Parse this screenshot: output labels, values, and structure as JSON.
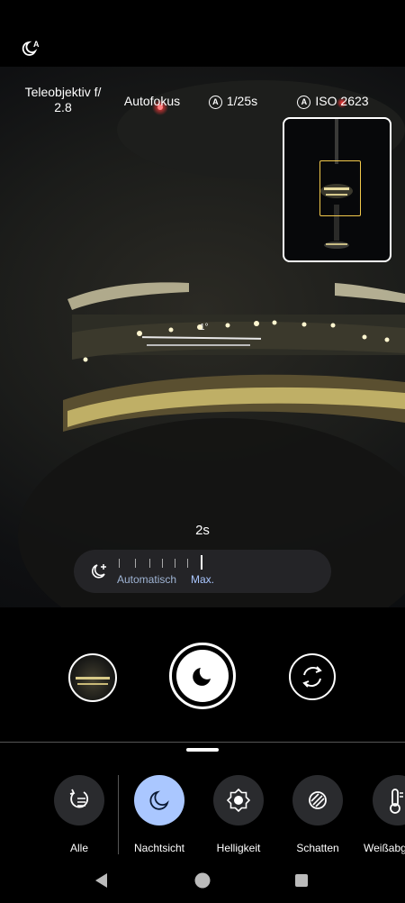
{
  "top": {
    "night_auto_icon": "night-auto-icon"
  },
  "info": {
    "lens": "Teleobjektiv f/\n2.8",
    "focus": "Autofokus",
    "shutter": "1/25s",
    "iso": "ISO 2623",
    "auto_badge": "A"
  },
  "level": {
    "angle": "1°"
  },
  "night": {
    "time": "2s",
    "auto_label": "Automatisch",
    "max_label": "Max."
  },
  "modes": [
    {
      "label": "Alle",
      "icon": "adjust-icon"
    },
    {
      "label": "Nachtsicht",
      "icon": "moon-icon"
    },
    {
      "label": "Helligkeit",
      "icon": "brightness-icon"
    },
    {
      "label": "Schatten",
      "icon": "shadows-icon"
    },
    {
      "label": "Weißabg",
      "icon": "thermometer-icon"
    }
  ],
  "colors": {
    "accent": "#aac7ff",
    "focus_box": "#f2c94c"
  }
}
